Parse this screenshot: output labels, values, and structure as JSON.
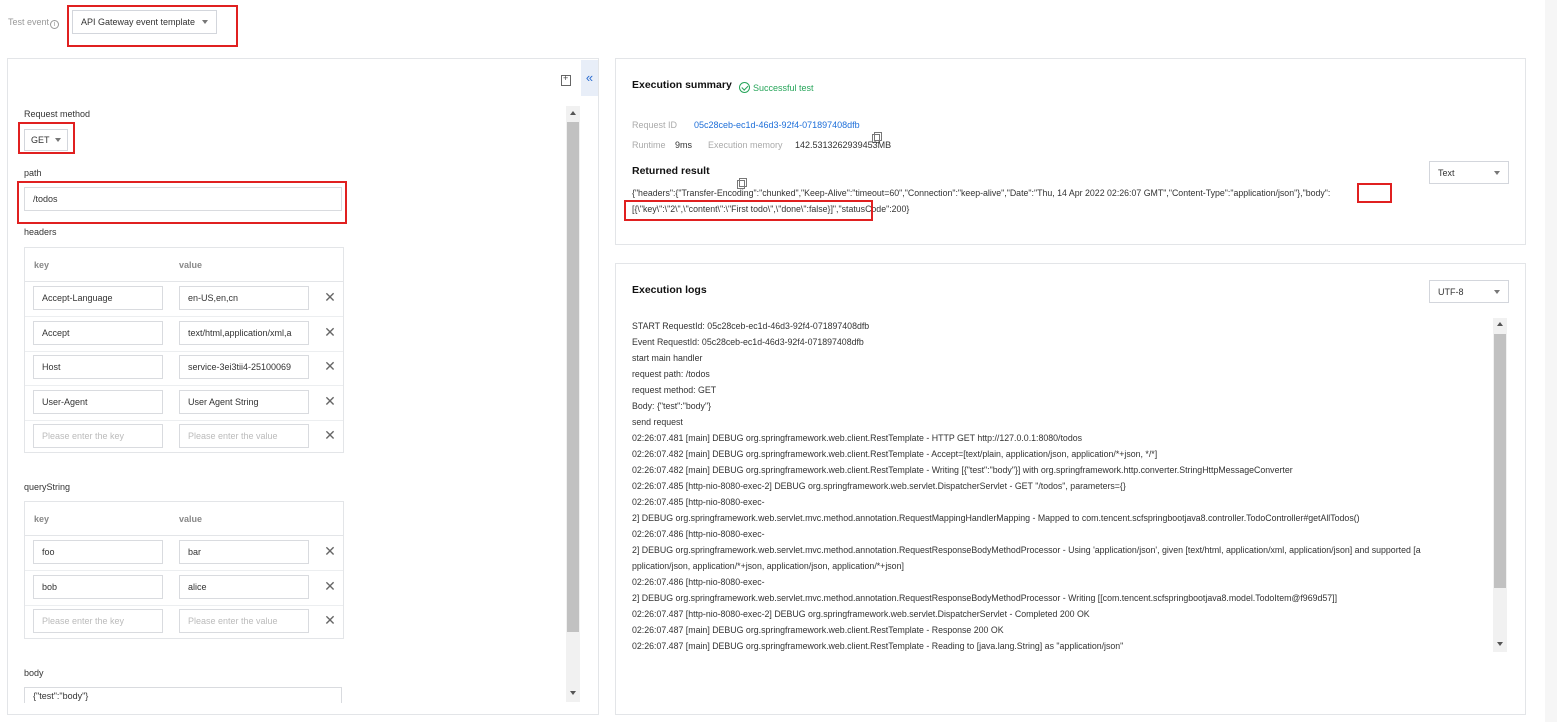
{
  "top": {
    "test_event_label": "Test event",
    "info_symbol": "i",
    "template_select_value": "API Gateway event template"
  },
  "request": {
    "method_label": "Request method",
    "method_value": "GET",
    "path_label": "path",
    "path_value": "/todos",
    "headers_label": "headers",
    "key_header": "key",
    "value_header": "value",
    "headers": [
      {
        "key": "Accept-Language",
        "value": "en-US,en,cn"
      },
      {
        "key": "Accept",
        "value": "text/html,application/xml,a"
      },
      {
        "key": "Host",
        "value": "service-3ei3tii4-25100069"
      },
      {
        "key": "User-Agent",
        "value": "User Agent String"
      }
    ],
    "key_placeholder": "Please enter the key",
    "value_placeholder": "Please enter the value",
    "query_label": "queryString",
    "query": [
      {
        "key": "foo",
        "value": "bar"
      },
      {
        "key": "bob",
        "value": "alice"
      }
    ],
    "body_label": "body",
    "body_value": "{\"test\":\"body\"}",
    "collapse_symbol": "«",
    "delete_symbol": "✕"
  },
  "summary": {
    "title": "Execution summary",
    "status": "Successful test",
    "request_id_label": "Request ID",
    "request_id": "05c28ceb-ec1d-46d3-92f4-071897408dfb",
    "runtime_label": "Runtime",
    "runtime_value": "9ms",
    "memory_label": "Execution memory",
    "memory_value": "142.5313262939453MB",
    "returned_label": "Returned result",
    "format_select": "Text",
    "result_line1": "{\"headers\":{\"Transfer-Encoding\":\"chunked\",\"Keep-Alive\":\"timeout=60\",\"Connection\":\"keep-alive\",\"Date\":\"Thu, 14 Apr 2022 02:26:07 GMT\",\"Content-Type\":\"application/json\"},\"body\":",
    "result_line2": "[{\\\"key\\\":\\\"2\\\",\\\"content\\\":\\\"First todo\\\",\\\"done\\\":false}]\",\"statusCode\":200}"
  },
  "logs": {
    "title": "Execution logs",
    "encoding_select": "UTF-8",
    "lines": [
      "START RequestId: 05c28ceb-ec1d-46d3-92f4-071897408dfb",
      "Event RequestId: 05c28ceb-ec1d-46d3-92f4-071897408dfb",
      "start main handler",
      "request path: /todos",
      "request method: GET",
      "Body: {\"test\":\"body\"}",
      "send request",
      "02:26:07.481 [main] DEBUG org.springframework.web.client.RestTemplate - HTTP GET http://127.0.0.1:8080/todos",
      "02:26:07.482 [main] DEBUG org.springframework.web.client.RestTemplate - Accept=[text/plain, application/json, application/*+json, */*]",
      "02:26:07.482 [main] DEBUG org.springframework.web.client.RestTemplate - Writing [{\"test\":\"body\"}] with org.springframework.http.converter.StringHttpMessageConverter",
      "02:26:07.485 [http-nio-8080-exec-2] DEBUG org.springframework.web.servlet.DispatcherServlet - GET \"/todos\", parameters={}",
      "02:26:07.485 [http-nio-8080-exec-",
      "2] DEBUG org.springframework.web.servlet.mvc.method.annotation.RequestMappingHandlerMapping - Mapped to com.tencent.scfspringbootjava8.controller.TodoController#getAllTodos()",
      "02:26:07.486 [http-nio-8080-exec-",
      "2] DEBUG org.springframework.web.servlet.mvc.method.annotation.RequestResponseBodyMethodProcessor - Using 'application/json', given [text/html, application/xml, application/json] and supported [a",
      "pplication/json, application/*+json, application/json, application/*+json]",
      "02:26:07.486 [http-nio-8080-exec-",
      "2] DEBUG org.springframework.web.servlet.mvc.method.annotation.RequestResponseBodyMethodProcessor - Writing [[com.tencent.scfspringbootjava8.model.TodoItem@f969d57]]",
      "02:26:07.487 [http-nio-8080-exec-2] DEBUG org.springframework.web.servlet.DispatcherServlet - Completed 200 OK",
      "02:26:07.487 [main] DEBUG org.springframework.web.client.RestTemplate - Response 200 OK",
      "02:26:07.487 [main] DEBUG org.springframework.web.client.RestTemplate - Reading to [java.lang.String] as \"application/json\""
    ]
  },
  "colors": {
    "highlight_box": "#e02020",
    "link": "#1e6fd9",
    "success": "#27a55a"
  }
}
